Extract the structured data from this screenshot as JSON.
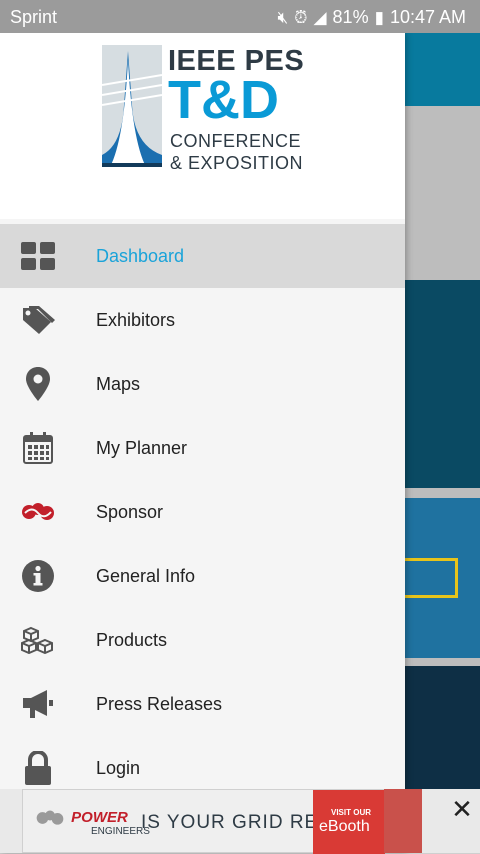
{
  "status_bar": {
    "carrier": "Sprint",
    "battery": "81%",
    "time": "10:47 AM",
    "icons": [
      "mute-icon",
      "alarm-icon",
      "lte-signal-icon",
      "battery-icon"
    ]
  },
  "logo": {
    "line1": "IEEE PES",
    "line2": "T&D",
    "line3": "CONFERENCE",
    "line4": "& EXPOSITION"
  },
  "menu": {
    "items": [
      {
        "label": "Dashboard",
        "icon": "dashboard-grid-icon",
        "active": true
      },
      {
        "label": "Exhibitors",
        "icon": "tags-icon",
        "active": false
      },
      {
        "label": "Maps",
        "icon": "map-pin-icon",
        "active": false
      },
      {
        "label": "My Planner",
        "icon": "calendar-icon",
        "active": false
      },
      {
        "label": "Sponsor",
        "icon": "sponsor-logo-icon",
        "active": false
      },
      {
        "label": "General Info",
        "icon": "info-icon",
        "active": false
      },
      {
        "label": "Products",
        "icon": "boxes-icon",
        "active": false
      },
      {
        "label": "Press Releases",
        "icon": "megaphone-icon",
        "active": false
      },
      {
        "label": "Login",
        "icon": "lock-icon",
        "active": false
      }
    ]
  },
  "ad": {
    "brand": "POWER",
    "brand_sub": "ENGINEERS",
    "headline": "IS YOUR GRID READY?",
    "cta_small": "VISIT OUR",
    "cta": "eBooth",
    "close": "✕"
  },
  "colors": {
    "accent": "#1aa3d9",
    "header": "#087a9e",
    "status_bar": "#9b9b9b",
    "active_row": "#d9d9d9"
  }
}
